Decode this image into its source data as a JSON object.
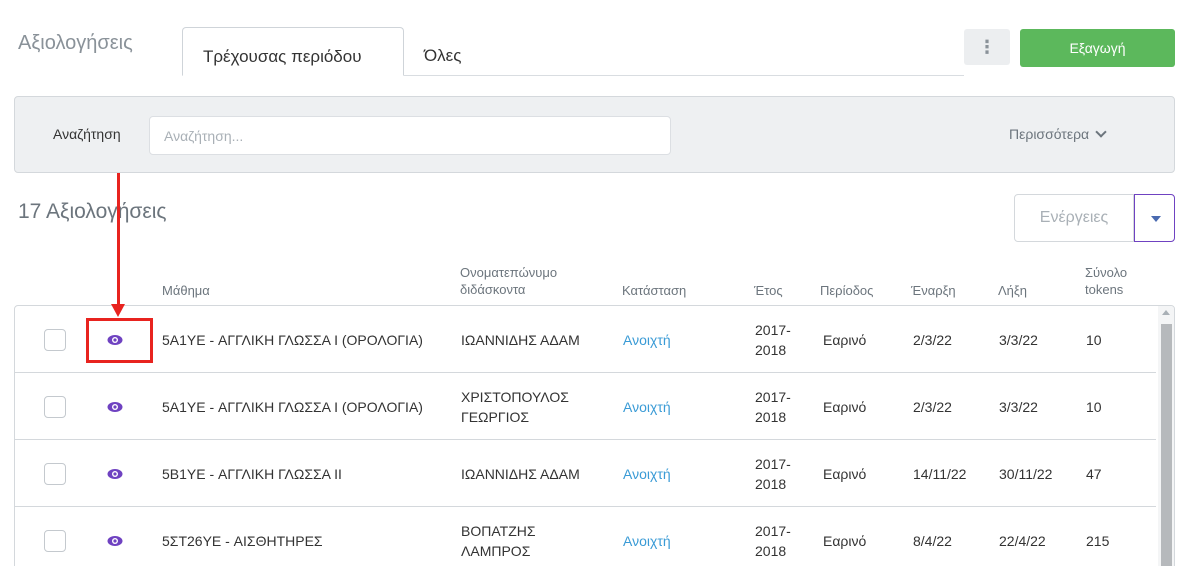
{
  "header": {
    "title": "Αξιολογήσεις",
    "tabs": [
      {
        "label": "Τρέχουσας περιόδου",
        "active": true
      },
      {
        "label": "Όλες",
        "active": false
      }
    ],
    "kebab_icon": "⋮",
    "export_label": "Εξαγωγή"
  },
  "search": {
    "label": "Αναζήτηση",
    "placeholder": "Αναζήτηση...",
    "value": "",
    "more_label": "Περισσότερα"
  },
  "results": {
    "count_text": "17 Αξιολογήσεις",
    "actions_label": "Ενέργειες"
  },
  "columns": {
    "course": "Μάθημα",
    "teacher": "Ονοματεπώνυμο διδάσκοντα",
    "status": "Κατάσταση",
    "year": "Έτος",
    "period": "Περίοδος",
    "start": "Έναρξη",
    "end": "Λήξη",
    "tokens": "Σύνολο tokens"
  },
  "rows": [
    {
      "course": "5A1YE - ΑΓΓΛΙΚΗ ΓΛΩΣΣΑ Ι (ΟΡΟΛΟΓΙΑ)",
      "teacher": "ΙΩΑΝΝΙΔΗΣ ΑΔΑΜ",
      "status": "Ανοιχτή",
      "year": "2017-2018",
      "period": "Εαρινό",
      "start": "2/3/22",
      "end": "3/3/22",
      "tokens": "10"
    },
    {
      "course": "5A1YE - ΑΓΓΛΙΚΗ ΓΛΩΣΣΑ Ι (ΟΡΟΛΟΓΙΑ)",
      "teacher": "ΧΡΙΣΤΟΠΟΥΛΟΣ ΓΕΩΡΓΙΟΣ",
      "status": "Ανοιχτή",
      "year": "2017-2018",
      "period": "Εαρινό",
      "start": "2/3/22",
      "end": "3/3/22",
      "tokens": "10"
    },
    {
      "course": "5B1YE - ΑΓΓΛΙΚΗ ΓΛΩΣΣΑ ΙΙ",
      "teacher": "ΙΩΑΝΝΙΔΗΣ ΑΔΑΜ",
      "status": "Ανοιχτή",
      "year": "2017-2018",
      "period": "Εαρινό",
      "start": "14/11/22",
      "end": "30/11/22",
      "tokens": "47"
    },
    {
      "course": "5ΣΤ26YE - ΑΙΣΘΗΤΗΡΕΣ",
      "teacher": "ΒΟΠΑΤΖΗΣ ΛΑΜΠΡΟΣ",
      "status": "Ανοιχτή",
      "year": "2017-2018",
      "period": "Εαρινό",
      "start": "8/4/22",
      "end": "22/4/22",
      "tokens": "215"
    }
  ],
  "colors": {
    "accent_green": "#5cb85c",
    "link_blue": "#3a9bd6",
    "eye_purple": "#6f42c1",
    "annotation_red": "#e8231f"
  },
  "icons": {
    "view": "eye-icon",
    "more": "chevron-down-icon",
    "actions_caret": "caret-down-icon",
    "kebab": "kebab-icon"
  }
}
